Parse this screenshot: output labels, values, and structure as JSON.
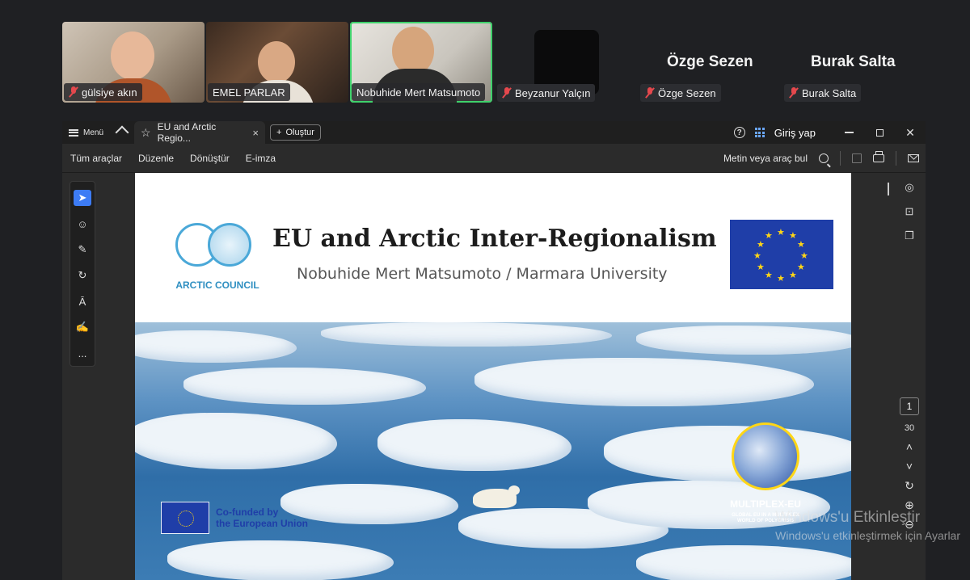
{
  "participants": [
    {
      "name": "gülsiye akın",
      "muted": true
    },
    {
      "name": "EMEL PARLAR",
      "muted": false
    },
    {
      "name": "Nobuhide Mert Matsumoto",
      "muted": false,
      "active_speaker": true
    },
    {
      "name": "Beyzanur Yalçın",
      "muted": true
    },
    {
      "name": "Özge Sezen",
      "muted": true,
      "display_name": "Özge Sezen"
    },
    {
      "name": "Burak Salta",
      "muted": true,
      "display_name": "Burak Salta"
    }
  ],
  "titlebar": {
    "menu_label": "Menü",
    "tab_title": "EU and Arctic Regio...",
    "tab_close": "×",
    "create_label": "Oluştur",
    "help": "?",
    "signin_label": "Giriş yap"
  },
  "toolbar": {
    "items": [
      "Tüm araçlar",
      "Düzenle",
      "Dönüştür",
      "E-imza"
    ],
    "search_label": "Metin veya araç bul"
  },
  "left_rail": {
    "more": "..."
  },
  "page_nav": {
    "current_page": "1",
    "total_pages": "30"
  },
  "slide": {
    "title": "EU and Arctic Inter-Regionalism",
    "subtitle": "Nobuhide Mert Matsumoto / Marmara University",
    "arctic_council": "ARCTIC COUNCIL",
    "cofunded_line1": "Co-funded by",
    "cofunded_line2": "the European Union",
    "multiplex_title": "MULTIPLEX-EU",
    "multiplex_sub1": "GLOBAL EU IN A MULTIPLEX",
    "multiplex_sub2": "WORLD OF POLYCRISIS"
  },
  "watermark": {
    "line1": "Windows'u Etkinleştir",
    "line2": "Windows'u etkinleştirmek için Ayarlar"
  },
  "colors": {
    "active_speaker_border": "#3fd16b",
    "mic_off": "#e5484d",
    "accent": "#3d7cf5",
    "eu_blue": "#1f3ea8",
    "eu_yellow": "#ffd616"
  }
}
